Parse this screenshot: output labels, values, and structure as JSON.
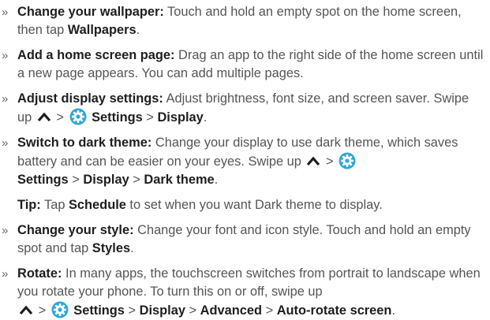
{
  "bullet_glyph": "»",
  "separator": ">",
  "period": ".",
  "colors": {
    "text": "#555555",
    "bold": "#1e1e1e",
    "gear_icon": "#2ea8d6"
  },
  "icons": {
    "swipe_up": "chevron-up-icon",
    "settings": "settings-gear-icon"
  },
  "items": {
    "wallpaper": {
      "title": "Change your wallpaper:",
      "text": " Touch and hold an empty spot on the home screen, then tap ",
      "action": "Wallpapers"
    },
    "home_page": {
      "title": "Add a home screen page:",
      "text": " Drag an app to the right side of the home screen until a new page appears. You can add multiple pages."
    },
    "display": {
      "title": "Adjust display settings:",
      "text": " Adjust brightness, font size, and screen saver. Swipe up ",
      "settings": "Settings",
      "display": "Display"
    },
    "dark": {
      "title": "Switch to dark theme:",
      "text": " Change your display to use dark theme, which saves battery and can be easier on your eyes. Swipe up ",
      "settings": "Settings",
      "display": "Display",
      "dark_theme": "Dark theme"
    },
    "tip": {
      "label": "Tip:",
      "text1": " Tap ",
      "schedule": "Schedule",
      "text2": " to set when you want Dark theme to display."
    },
    "style": {
      "title": "Change your style:",
      "text": " Change your font and icon style. Touch and hold an empty spot and tap ",
      "styles": "Styles"
    },
    "rotate": {
      "title": "Rotate:",
      "text": " In many apps, the touchscreen switches from portrait to landscape when you rotate your phone. To turn this on or off, swipe up ",
      "settings": "Settings",
      "display": "Display",
      "advanced": "Advanced",
      "auto_rotate": "Auto-rotate screen"
    }
  }
}
